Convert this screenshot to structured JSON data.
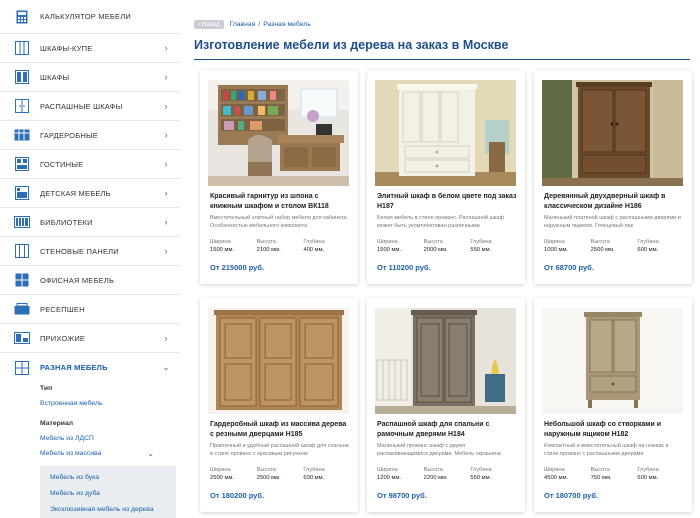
{
  "sidebar": {
    "items": [
      {
        "label": "КАЛЬКУЛЯТОР МЕБЕЛИ",
        "icon": "calculator-icon",
        "chevron": ""
      },
      {
        "label": "ШКАФЫ-КУПЕ",
        "icon": "wardrobe-sliding-icon",
        "chevron": "›"
      },
      {
        "label": "ШКАФЫ",
        "icon": "wardrobe-icon",
        "chevron": "›"
      },
      {
        "label": "РАСПАШНЫЕ ШКАФЫ",
        "icon": "swing-wardrobe-icon",
        "chevron": "›"
      },
      {
        "label": "ГАРДЕРОБНЫЕ",
        "icon": "dressing-room-icon",
        "chevron": "›"
      },
      {
        "label": "ГОСТИНЫЕ",
        "icon": "living-room-icon",
        "chevron": "›"
      },
      {
        "label": "ДЕТСКАЯ МЕБЕЛЬ",
        "icon": "kids-furniture-icon",
        "chevron": "›"
      },
      {
        "label": "БИБЛИОТЕКИ",
        "icon": "library-icon",
        "chevron": "›"
      },
      {
        "label": "СТЕНОВЫЕ ПАНЕЛИ",
        "icon": "wall-panels-icon",
        "chevron": "›"
      },
      {
        "label": "ОФИСНАЯ МЕБЕЛЬ",
        "icon": "office-furniture-icon",
        "chevron": ""
      },
      {
        "label": "РЕСЕПШЕН",
        "icon": "reception-icon",
        "chevron": ""
      },
      {
        "label": "ПРИХОЖИЕ",
        "icon": "hallway-icon",
        "chevron": "›"
      },
      {
        "label": "РАЗНАЯ МЕБЕЛЬ",
        "icon": "misc-furniture-icon",
        "chevron": "⌄"
      }
    ],
    "submenu": {
      "type_heading": "Тип",
      "type_link": "Встроенная мебель",
      "material_heading": "Материал",
      "material_links": [
        "Мебель из ЛДСП",
        "Мебель из массива"
      ],
      "expand_chevron": "⌄",
      "nested_links": [
        "Мебель из бука",
        "Мебель из дуба",
        "Эксклюзивная мебель из дерева"
      ]
    }
  },
  "breadcrumb": {
    "back": "‹ Назад",
    "home": "Главная",
    "separator": "/",
    "current": "Разная мебель"
  },
  "page_title": "Изготовление мебели из дерева на заказ в Москве",
  "labels": {
    "width": "Ширина",
    "height": "Высота",
    "depth": "Глубина"
  },
  "products": [
    {
      "title": "Красивый гарнитур из шпона с книжным шкафом и столом ВК118",
      "desc": "Вместительный элитный набор мебели для кабинета. Особенностью мебельного комплекта",
      "width": "1500 мм.",
      "height": "2100 мм.",
      "depth": "400 мм.",
      "price": "От 215000 руб."
    },
    {
      "title": "Элитный шкаф в белом цвете под заказ Н187",
      "desc": "Белая мебель в стиле прованс. Распашной шкаф может быть укомплектован различными",
      "width": "1500 мм.",
      "height": "2000 мм.",
      "depth": "550 мм.",
      "price": "От 110200 руб."
    },
    {
      "title": "Деревянный двухдверный шкаф в классическом дизайне Н186",
      "desc": "Маленький платяной шкаф с распашными дверями и наружным ящиком. Глянцевый лак",
      "width": "1000 мм.",
      "height": "2500 мм.",
      "depth": "600 мм.",
      "price": "От 68700 руб."
    },
    {
      "title": "Гардеробный шкаф из массива дерева с резными дверцами Н185",
      "desc": "Практичный и удобный распашной шкаф для спальни в стиле прованс с красивым рисунком",
      "width": "2500 мм.",
      "height": "2500 мм.",
      "depth": "600 мм.",
      "price": "От 180200 руб."
    },
    {
      "title": "Распашной шкаф для спальни с рамочным дверями Н184",
      "desc": "Маленький прованс шкаф с двумя распахивающимися дверями. Мебель окрашена",
      "width": "1200 мм.",
      "height": "2200 мм.",
      "depth": "550 мм.",
      "price": "От 98700 руб."
    },
    {
      "title": "Небольшой шкаф со створками и наружным ящиком Н182",
      "desc": "Компактный и вместительный шкаф на ножках в стиле прованс с распашными дверями",
      "width": "4500 мм.",
      "height": "750 мм.",
      "depth": "600 мм.",
      "price": "От 180700 руб."
    }
  ],
  "colors": {
    "accent": "#1f4e8c",
    "link": "#1a5ea8",
    "price": "#1f5ea8",
    "icon": "#2a6fb8"
  }
}
